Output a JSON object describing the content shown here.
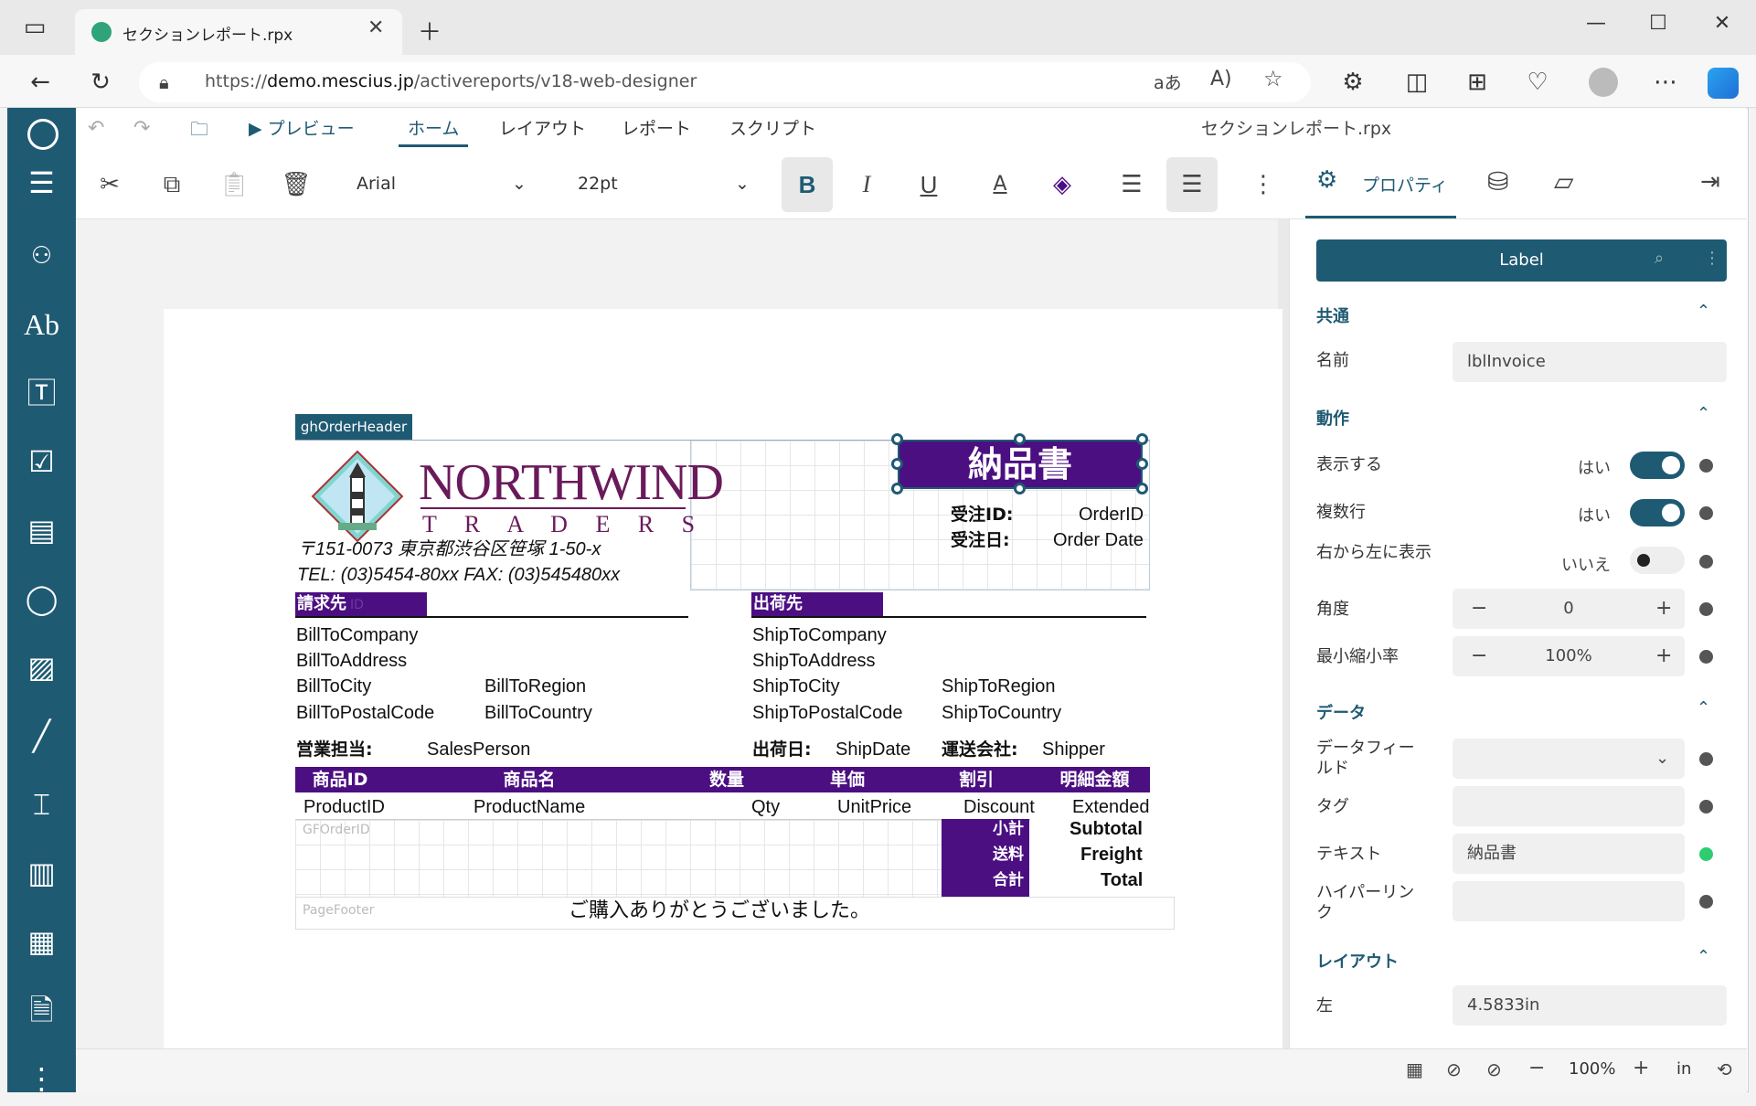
{
  "browser": {
    "tab_title": "セクションレポート.rpx",
    "url_prefix": "https://",
    "url_domain": "demo.mescius.jp",
    "url_path": "/activereports/v18-web-designer"
  },
  "menu": {
    "preview": "プレビュー",
    "tabs": [
      "ホーム",
      "レイアウト",
      "レポート",
      "スクリプト"
    ],
    "document_title": "セクションレポート.rpx"
  },
  "toolbar": {
    "font_family": "Arial",
    "font_size": "22pt"
  },
  "panel_tabs": {
    "properties": "プロパティ"
  },
  "report": {
    "section_header": "ghOrderHeader",
    "title": "納品書",
    "logo_main": "NORTHWIND",
    "logo_sub": "T R A D E R S",
    "address": "〒151-0073 東京都渋谷区笹塚 1-50-x",
    "tel": "TEL: (03)5454-80xx FAX: (03)545480xx",
    "order_id_label": "受注ID:",
    "order_id_value": "OrderID",
    "order_date_label": "受注日:",
    "order_date_value": "Order Date",
    "bill_to": "請求先",
    "bill_to_ghost": "ID",
    "ship_to": "出荷先",
    "bill_company": "BillToCompany",
    "bill_address": "BillToAddress",
    "bill_city": "BillToCity",
    "bill_region": "BillToRegion",
    "bill_postal": "BillToPostalCode",
    "bill_country": "BillToCountry",
    "ship_company": "ShipToCompany",
    "ship_address": "ShipToAddress",
    "ship_city": "ShipToCity",
    "ship_region": "ShipToRegion",
    "ship_postal": "ShipToPostalCode",
    "ship_country": "ShipToCountry",
    "sales_label": "営業担当:",
    "sales_value": "SalesPerson",
    "shipdate_label": "出荷日:",
    "shipdate_value": "ShipDate",
    "shipper_label": "運送会社:",
    "shipper_value": "Shipper",
    "columns": [
      "商品ID",
      "商品名",
      "数量",
      "単価",
      "割引",
      "明細金額"
    ],
    "detail": [
      "ProductID",
      "ProductName",
      "Qty",
      "UnitPrice",
      "Discount",
      "Extended"
    ],
    "footer_section": "GFOrderID",
    "subtotal_label": "小計",
    "subtotal_value": "Subtotal",
    "freight_label": "送料",
    "freight_value": "Freight",
    "total_label": "合計",
    "total_value": "Total",
    "page_footer": "PageFooter",
    "thanks": "ご購入ありがとうございました。"
  },
  "properties": {
    "control_type": "Label",
    "sections": {
      "common": "共通",
      "behavior": "動作",
      "data": "データ",
      "layout": "レイアウト"
    },
    "name_label": "名前",
    "name_value": "lblInvoice",
    "visible_label": "表示する",
    "visible_value": "はい",
    "multiline_label": "複数行",
    "multiline_value": "はい",
    "rtl_label": "右から左に表示",
    "rtl_value": "いいえ",
    "angle_label": "角度",
    "angle_value": "0",
    "minscale_label": "最小縮小率",
    "minscale_value": "100%",
    "datafield_label": "データフィールド",
    "tag_label": "タグ",
    "text_label": "テキスト",
    "text_value": "納品書",
    "hyperlink_label": "ハイパーリンク",
    "left_label": "左",
    "left_value": "4.5833in"
  },
  "status": {
    "zoom": "100%",
    "unit": "in"
  },
  "colors": {
    "brand": "#1f5a73",
    "report_purple": "#4b0f82",
    "text_set_dot": "#2ecc71"
  }
}
